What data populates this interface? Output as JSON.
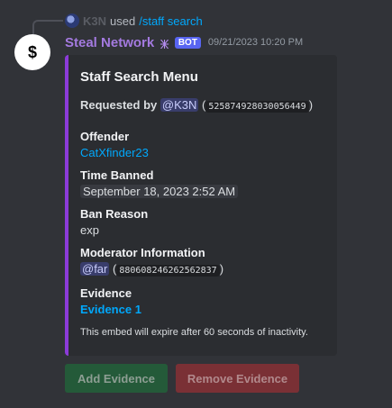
{
  "reply": {
    "username": "K3N",
    "used_text": "used",
    "command": "/staff search"
  },
  "message": {
    "avatar_icon": "dollar-sign",
    "avatar_glyph": "$",
    "username": "Steal Network",
    "emoji_glyph": "🜹",
    "bot_badge": "BOT",
    "timestamp": "09/21/2023 10:20 PM"
  },
  "embed": {
    "title": "Staff Search Menu",
    "requested_by_label": "Requested by",
    "requested_by_mention": "@K3N",
    "requested_by_id": "525874928030056449",
    "fields": [
      {
        "name": "Offender",
        "value": "CatXfinder23"
      },
      {
        "name": "Time Banned",
        "value": "September 18, 2023 2:52 AM"
      },
      {
        "name": "Ban Reason",
        "value": "exp"
      },
      {
        "name": "Moderator Information",
        "mention": "@far",
        "id": "880608246262562837"
      },
      {
        "name": "Evidence",
        "value": "Evidence 1"
      }
    ],
    "footer": "This embed will expire after 60 seconds of inactivity.",
    "accent_color": "#8c3bd9"
  },
  "buttons": {
    "add_evidence": "Add Evidence",
    "remove_evidence": "Remove Evidence"
  }
}
